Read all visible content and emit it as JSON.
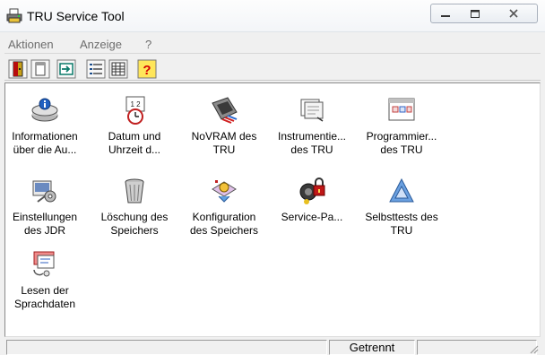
{
  "window": {
    "title": "TRU Service Tool",
    "app_icon": "printer-icon"
  },
  "menu": [
    {
      "label": "Aktionen"
    },
    {
      "label": "Anzeige"
    },
    {
      "label": "?"
    }
  ],
  "toolbar": [
    {
      "icon": "exit-door-icon"
    },
    {
      "icon": "window-view-icon"
    },
    {
      "icon": "forward-arrow-icon"
    },
    {
      "icon": "list-view-icon"
    },
    {
      "icon": "details-view-icon"
    },
    {
      "icon": "help-icon"
    }
  ],
  "items": [
    {
      "line1": "Informationen",
      "line2": "über die Au...",
      "icon": "info-disk-icon"
    },
    {
      "line1": "Datum und",
      "line2": "Uhrzeit d...",
      "icon": "calendar-clock-icon"
    },
    {
      "line1": "NoVRAM des",
      "line2": "TRU",
      "icon": "memory-chip-icon"
    },
    {
      "line1": "Instrumentie...",
      "line2": "des TRU",
      "icon": "instrumentation-icon"
    },
    {
      "line1": "Programmier...",
      "line2": "des TRU",
      "icon": "calendar-schedule-icon"
    },
    {
      "line1": "Einstellungen",
      "line2": "des JDR",
      "icon": "settings-tools-icon"
    },
    {
      "line1": "Löschung des",
      "line2": "Speichers",
      "icon": "trash-bin-icon"
    },
    {
      "line1": "Konfiguration",
      "line2": "des Speichers",
      "icon": "memory-config-icon"
    },
    {
      "line1": "Service-Pa...",
      "line2": "",
      "icon": "service-lock-icon"
    },
    {
      "line1": "Selbsttests des",
      "line2": "TRU",
      "icon": "triangle-test-icon"
    },
    {
      "line1": "Lesen der",
      "line2": "Sprachdaten",
      "icon": "speech-data-icon"
    }
  ],
  "statusbar": {
    "connection": "Getrennt"
  }
}
